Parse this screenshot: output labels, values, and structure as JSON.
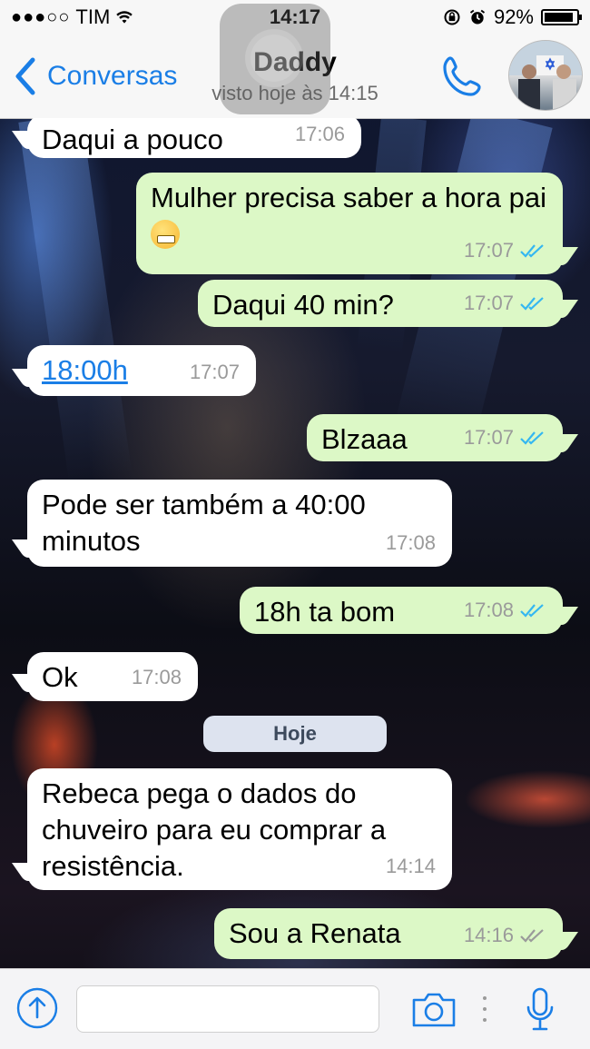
{
  "status_bar": {
    "carrier": "TIM",
    "signal_dots": "●●●○○",
    "time": "14:17",
    "battery": "92%",
    "battery_level": 0.92
  },
  "header": {
    "back_label": "Conversas",
    "contact_name": "Daddy",
    "last_seen": "visto hoje às 14:15"
  },
  "messages": [
    {
      "dir": "in",
      "text": "Daqui a pouco",
      "time": "17:06"
    },
    {
      "dir": "out",
      "text": "Mulher precisa saber a hora pai",
      "time": "17:07",
      "ticks": "read",
      "emoji": "grimacing-face"
    },
    {
      "dir": "out",
      "text": "Daqui 40 min?",
      "time": "17:07",
      "ticks": "read"
    },
    {
      "dir": "in",
      "text": "18:00h",
      "time": "17:07",
      "link": true
    },
    {
      "dir": "out",
      "text": "Blzaaa",
      "time": "17:07",
      "ticks": "read"
    },
    {
      "dir": "in",
      "text": "Pode ser também a 40:00 minutos",
      "time": "17:08"
    },
    {
      "dir": "out",
      "text": "18h ta bom",
      "time": "17:08",
      "ticks": "read"
    },
    {
      "dir": "in",
      "text": "Ok",
      "time": "17:08"
    },
    {
      "dir": "in",
      "text": "Rebeca pega o dados do chuveiro para eu comprar a resistência.",
      "time": "14:14"
    },
    {
      "dir": "out",
      "text": "Sou a Renata",
      "time": "14:16",
      "ticks": "delivered"
    }
  ],
  "day_separator": "Hoje",
  "colors": {
    "accent": "#1a7ee6",
    "outgoing_bubble": "#dcf8c6",
    "incoming_bubble": "#ffffff",
    "read_ticks": "#34b7f1",
    "delivered_ticks": "#9a9a9a"
  },
  "icons": {
    "back": "chevron-left-icon",
    "call": "phone-icon",
    "attach": "upload-arrow-icon",
    "camera": "camera-icon",
    "mic": "microphone-icon"
  }
}
